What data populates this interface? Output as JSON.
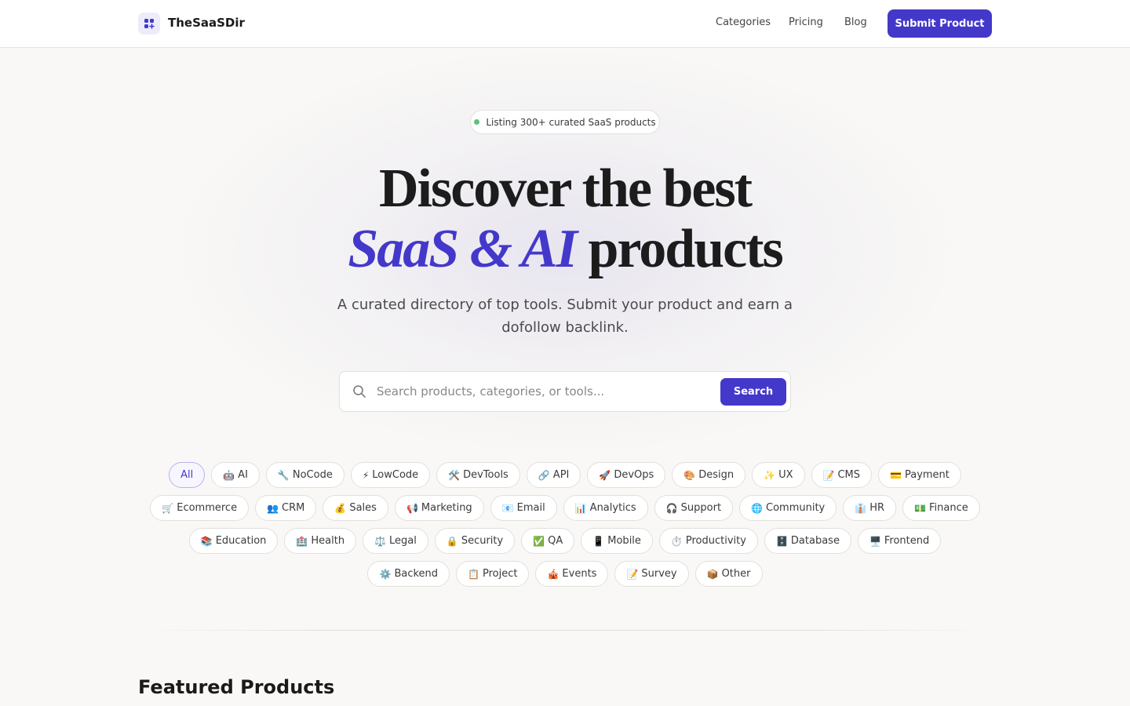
{
  "header": {
    "brand": "TheSaaSDir",
    "nav": [
      {
        "label": "Categories"
      },
      {
        "label": "Pricing"
      },
      {
        "label": "Blog"
      }
    ],
    "submit_label": "Submit Product"
  },
  "hero": {
    "badge": "Listing 300+ curated SaaS products",
    "title_line1": "Discover the best",
    "title_accent": "SaaS & AI",
    "title_line2_rest": " products",
    "subtitle": "A curated directory of top tools. Submit your product and earn a dofollow backlink."
  },
  "search": {
    "placeholder": "Search products, categories, or tools...",
    "button_label": "Search"
  },
  "categories": [
    {
      "emoji": "",
      "label": "All"
    },
    {
      "emoji": "🤖",
      "label": "AI"
    },
    {
      "emoji": "🔧",
      "label": "NoCode"
    },
    {
      "emoji": "⚡",
      "label": "LowCode"
    },
    {
      "emoji": "🛠️",
      "label": "DevTools"
    },
    {
      "emoji": "🔗",
      "label": "API"
    },
    {
      "emoji": "🚀",
      "label": "DevOps"
    },
    {
      "emoji": "🎨",
      "label": "Design"
    },
    {
      "emoji": "✨",
      "label": "UX"
    },
    {
      "emoji": "📝",
      "label": "CMS"
    },
    {
      "emoji": "💳",
      "label": "Payment"
    },
    {
      "emoji": "🛒",
      "label": "Ecommerce"
    },
    {
      "emoji": "👥",
      "label": "CRM"
    },
    {
      "emoji": "💰",
      "label": "Sales"
    },
    {
      "emoji": "📢",
      "label": "Marketing"
    },
    {
      "emoji": "📧",
      "label": "Email"
    },
    {
      "emoji": "📊",
      "label": "Analytics"
    },
    {
      "emoji": "🎧",
      "label": "Support"
    },
    {
      "emoji": "🌐",
      "label": "Community"
    },
    {
      "emoji": "👔",
      "label": "HR"
    },
    {
      "emoji": "💵",
      "label": "Finance"
    },
    {
      "emoji": "📚",
      "label": "Education"
    },
    {
      "emoji": "🏥",
      "label": "Health"
    },
    {
      "emoji": "⚖️",
      "label": "Legal"
    },
    {
      "emoji": "🔒",
      "label": "Security"
    },
    {
      "emoji": "✅",
      "label": "QA"
    },
    {
      "emoji": "📱",
      "label": "Mobile"
    },
    {
      "emoji": "⏱️",
      "label": "Productivity"
    },
    {
      "emoji": "🗄️",
      "label": "Database"
    },
    {
      "emoji": "🖥️",
      "label": "Frontend"
    },
    {
      "emoji": "⚙️",
      "label": "Backend"
    },
    {
      "emoji": "📋",
      "label": "Project"
    },
    {
      "emoji": "🎪",
      "label": "Events"
    },
    {
      "emoji": "📝",
      "label": "Survey"
    },
    {
      "emoji": "📦",
      "label": "Other"
    }
  ],
  "selected_category": "All",
  "featured": {
    "title": "Featured Products"
  },
  "colors": {
    "accent": "#4338ca",
    "background": "#f9f8f6",
    "status_dot": "#5fbf7e"
  }
}
